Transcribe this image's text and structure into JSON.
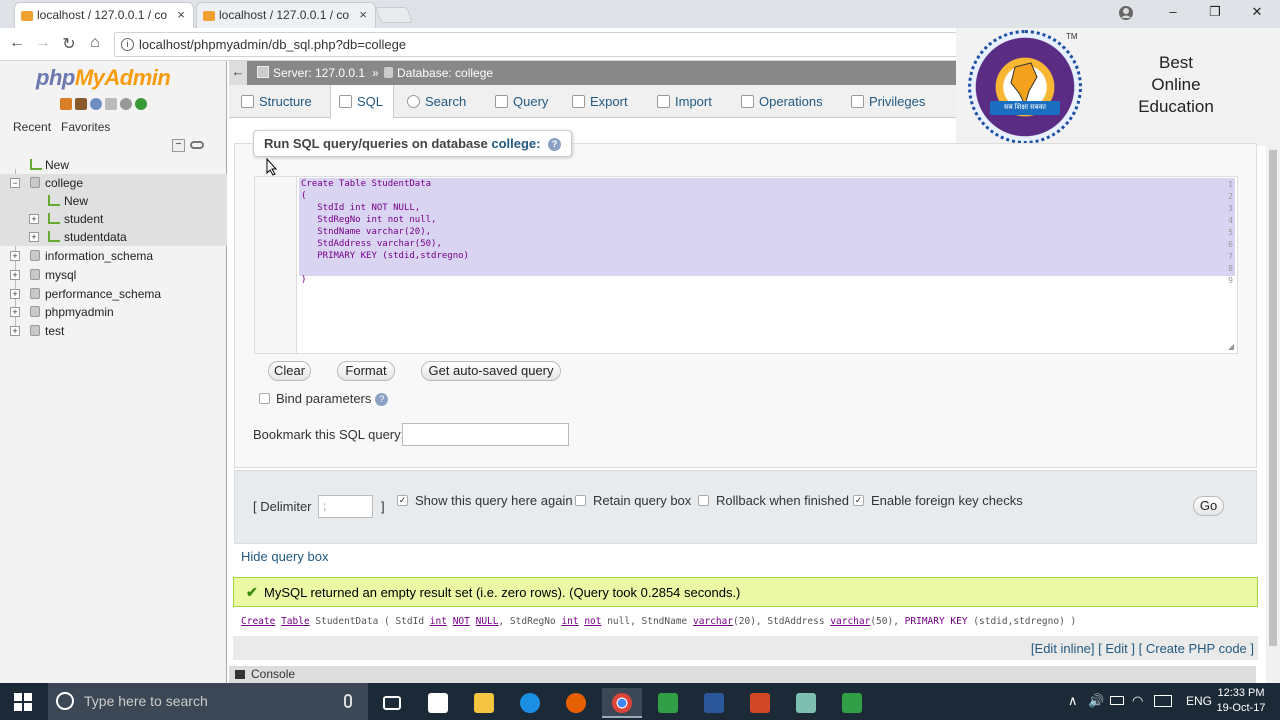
{
  "browser": {
    "tabs": [
      {
        "title": "localhost / 127.0.0.1 / co",
        "active": true
      },
      {
        "title": "localhost / 127.0.0.1 / co",
        "active": false
      }
    ],
    "url": "localhost/phpmyadmin/db_sql.php?db=college",
    "window_controls": {
      "minimize": "–",
      "maximize": "❐",
      "close": "✕"
    }
  },
  "sidebar": {
    "logo_php": "php",
    "logo_myadmin": "MyAdmin",
    "tabs": [
      "Recent",
      "Favorites"
    ],
    "tree": [
      {
        "label": "New",
        "level": 0,
        "type": "new"
      },
      {
        "label": "college",
        "level": 0,
        "type": "db",
        "expanded": true,
        "selected": true
      },
      {
        "label": "New",
        "level": 1,
        "type": "new"
      },
      {
        "label": "student",
        "level": 1,
        "type": "table"
      },
      {
        "label": "studentdata",
        "level": 1,
        "type": "table"
      },
      {
        "label": "information_schema",
        "level": 0,
        "type": "db"
      },
      {
        "label": "mysql",
        "level": 0,
        "type": "db"
      },
      {
        "label": "performance_schema",
        "level": 0,
        "type": "db"
      },
      {
        "label": "phpmyadmin",
        "level": 0,
        "type": "db"
      },
      {
        "label": "test",
        "level": 0,
        "type": "db"
      }
    ]
  },
  "breadcrumb": {
    "server": "Server: 127.0.0.1",
    "separator": "»",
    "database": "Database: college"
  },
  "main_tabs": [
    "Structure",
    "SQL",
    "Search",
    "Query",
    "Export",
    "Import",
    "Operations",
    "Privileges"
  ],
  "active_tab": "SQL",
  "overlay": {
    "line1": "Best",
    "line2": "Online",
    "line3": "Education",
    "tm": "TM",
    "emblem_text": "सब शिक्षा सबका"
  },
  "query": {
    "legend_prefix": "Run SQL query/queries on database",
    "legend_db": "college:",
    "line_numbers": [
      "1",
      "2",
      "3",
      "4",
      "5",
      "6",
      "7",
      "8",
      "9"
    ],
    "code_lines": [
      "Create Table StudentData",
      "(",
      "   StdId int NOT NULL,",
      "   StdRegNo int not null,",
      "   StndName varchar(20),",
      "   StdAddress varchar(50),",
      "   PRIMARY KEY (stdid,stdregno)",
      "",
      ")"
    ],
    "buttons": {
      "clear": "Clear",
      "format": "Format",
      "autosaved": "Get auto-saved query"
    },
    "bind_parameters": "Bind parameters",
    "bookmark_label": "Bookmark this SQL query:",
    "bookmark_value": ""
  },
  "options": {
    "delimiter_open": "[ Delimiter",
    "delimiter_value": ";",
    "delimiter_close": "]",
    "show_query_again": "Show this query here again",
    "show_query_again_checked": true,
    "retain_query_box": "Retain query box",
    "retain_query_box_checked": false,
    "rollback": "Rollback when finished",
    "rollback_checked": false,
    "foreign_keys": "Enable foreign key checks",
    "foreign_keys_checked": true,
    "go": "Go"
  },
  "hide_query_box": "Hide query box",
  "result": {
    "message": "MySQL returned an empty result set (i.e. zero rows). (Query took 0.2854 seconds.)",
    "sql_rest": " StudentData ( StdId ",
    "links": [
      "[Edit inline]",
      "[ Edit ]",
      "[ Create PHP code ]"
    ]
  },
  "console_label": "Console",
  "taskbar": {
    "search_placeholder": "Type here to search",
    "lang": "ENG",
    "time": "12:33 PM",
    "date": "19-Oct-17"
  }
}
